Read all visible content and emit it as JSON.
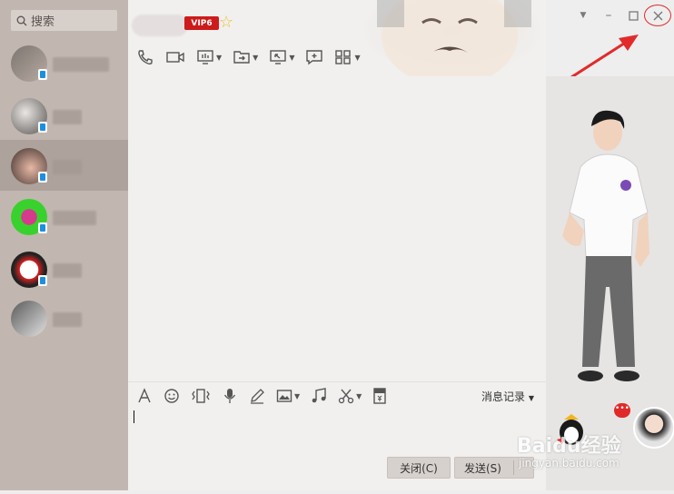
{
  "sidebar": {
    "search": {
      "placeholder": "搜索",
      "icon": "search-icon"
    },
    "contacts_count": 6
  },
  "chat_header": {
    "vip_badge": "VIP6",
    "star_icon": "star-icon"
  },
  "toolbar_top": [
    {
      "icon": "phone-icon"
    },
    {
      "icon": "video-icon"
    },
    {
      "icon": "screen-share-icon"
    },
    {
      "icon": "file-transfer-icon"
    },
    {
      "icon": "remote-desktop-icon"
    },
    {
      "icon": "chat-add-icon"
    },
    {
      "icon": "apps-icon"
    }
  ],
  "input_toolbar": [
    {
      "icon": "font-icon"
    },
    {
      "icon": "emoji-icon"
    },
    {
      "icon": "shake-icon"
    },
    {
      "icon": "mic-icon"
    },
    {
      "icon": "pen-icon"
    },
    {
      "icon": "image-icon"
    },
    {
      "icon": "music-icon"
    },
    {
      "icon": "scissors-icon"
    },
    {
      "icon": "red-packet-icon"
    }
  ],
  "history_label": "消息记录",
  "buttons": {
    "close_label": "关闭(C)",
    "send_label": "发送(S)"
  },
  "watermark": {
    "brand": "Baidu经验",
    "url": "jingyan.baidu.com"
  },
  "colors": {
    "vip_red": "#cc1b1b",
    "annotation_red": "#e12b2b",
    "mobile_blue": "#1b8fe0"
  }
}
